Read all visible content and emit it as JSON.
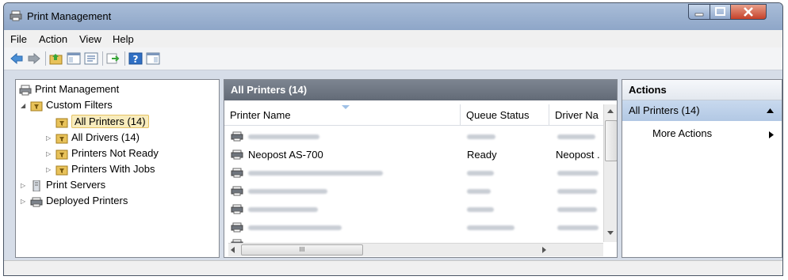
{
  "window": {
    "title": "Print Management"
  },
  "menu": [
    "File",
    "Action",
    "View",
    "Help"
  ],
  "tree": {
    "root": "Print Management",
    "custom_filters": "Custom Filters",
    "filters": [
      "All Printers (14)",
      "All Drivers (14)",
      "Printers Not Ready",
      "Printers With Jobs"
    ],
    "print_servers": "Print Servers",
    "deployed": "Deployed Printers"
  },
  "list": {
    "title": "All Printers (14)",
    "columns": [
      "Printer Name",
      "Queue Status",
      "Driver Na"
    ],
    "visible_row": {
      "name": "Neopost AS-700",
      "status": "Ready",
      "driver": "Neopost ."
    }
  },
  "actions": {
    "title": "Actions",
    "section": "All Printers (14)",
    "more": "More Actions"
  },
  "hscroll_grip": "III"
}
